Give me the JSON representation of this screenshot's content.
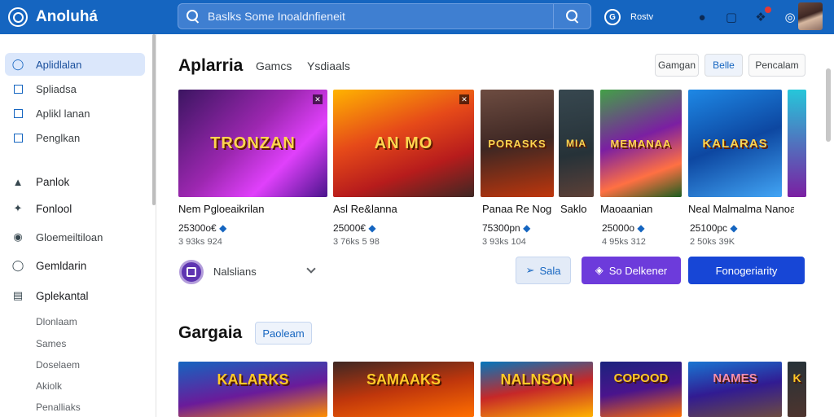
{
  "app": {
    "name": "Anoluhá"
  },
  "search": {
    "value": "Baslks Some Inoaldnfieneit"
  },
  "topbar": {
    "account_label": "Rostv"
  },
  "sidebar": {
    "items": [
      {
        "label": "Aplidlalan",
        "active": true
      },
      {
        "label": "Spliadsa"
      },
      {
        "label": "Aplikl lanan"
      },
      {
        "label": "Penglkan"
      },
      {
        "label": "Panlok"
      },
      {
        "label": "Fonlool"
      },
      {
        "label": "Gloemeiltiloan"
      },
      {
        "label": "Gemldarin"
      },
      {
        "label": "Gplekantal"
      }
    ],
    "subitems": [
      "Dlonlaam",
      "Sames",
      "Doselaem",
      "Akiolk",
      "Penalliaks"
    ]
  },
  "section1": {
    "title": "Aplarria",
    "tabs": [
      "Gamcs",
      "Ysdiaals"
    ],
    "buttons": [
      "Gamgan",
      "Belle",
      "Pencalam"
    ],
    "cards": [
      {
        "art": "TRONZAN",
        "name": "Nem Pgloeaikrilan",
        "price": "25300o€",
        "meta": "3 93ks 924"
      },
      {
        "art": "AN MO",
        "name": "Asl Re&lanna",
        "price": "25000€",
        "meta": "3 76ks 5 98"
      },
      {
        "art": "PORASKS",
        "name": "Panaa Re Nog",
        "price": "75300pn",
        "meta": "3 93ks 104"
      },
      {
        "art": "MIA",
        "name": "Saklo",
        "price": "",
        "meta": ""
      },
      {
        "art": "MEMANAA",
        "name": "Maoaanian",
        "price": "25000o",
        "meta": "4 95ks 312"
      },
      {
        "art": "KALARAS",
        "name": "Neal Malmalma Nanoar",
        "price": "25100pc",
        "meta": "2 50ks 39K"
      }
    ],
    "filter_label": "Nalslians",
    "actions": [
      "Sala",
      "So Delkener",
      "Fonogeriarity"
    ]
  },
  "section2": {
    "title": "Gargaia",
    "pill": "Paoleam",
    "cards": [
      {
        "art": "KALARKS"
      },
      {
        "art": "SAMAAKS"
      },
      {
        "art": "NALNSON"
      },
      {
        "art": "COPOOD"
      },
      {
        "art": "NAMES"
      },
      {
        "art": "K"
      }
    ]
  },
  "colors": {
    "topbar": "#1565c0",
    "accent": "#1565c0",
    "purple": "#6d3bdb",
    "blue": "#1746d6"
  }
}
